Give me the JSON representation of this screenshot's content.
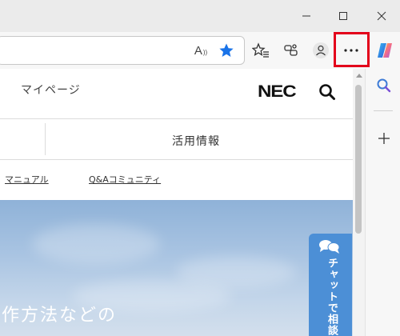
{
  "window": {
    "minimize_icon": "minimize-icon",
    "maximize_icon": "maximize-icon",
    "close_icon": "close-icon"
  },
  "toolbar": {
    "read_aloud": "A",
    "read_aloud_sup": "))",
    "icons": [
      "read-aloud-icon",
      "favorite-star-icon",
      "favorites-icon",
      "collections-icon",
      "profile-icon",
      "more-dots-icon",
      "copilot-icon"
    ],
    "more_label": "···",
    "highlight_color": "#e3001b",
    "star_color": "#1a73e8"
  },
  "sidebar": {
    "icons": [
      "search-icon",
      "add-icon"
    ]
  },
  "page": {
    "mypage": "マイページ",
    "logo": "NEC",
    "nav_usage": "活用情報",
    "links": {
      "manual": "マニュアル",
      "qa": "Q&Aコミュニティ"
    },
    "hero_text": "作方法などの",
    "chat_label": "チャットで相談"
  }
}
